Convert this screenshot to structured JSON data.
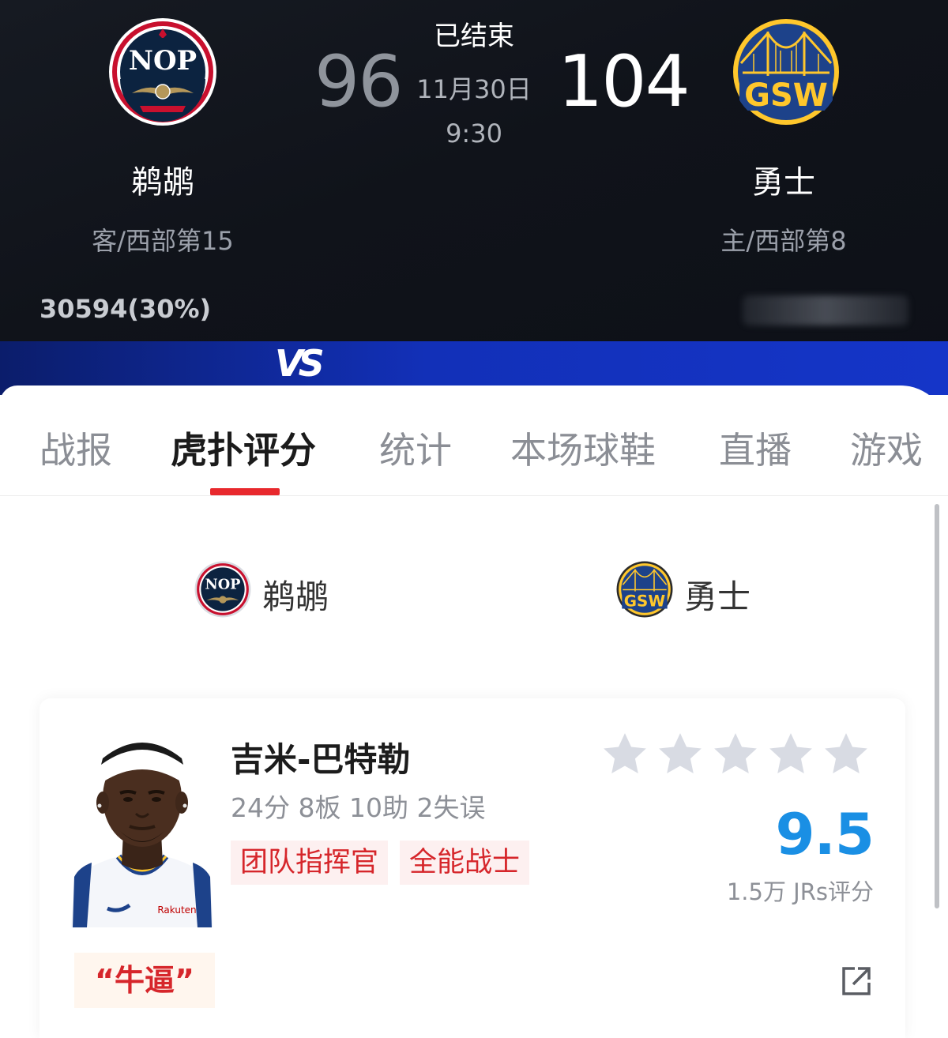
{
  "header": {
    "status": "已结束",
    "date": "11月30日",
    "time": "9:30",
    "away": {
      "name": "鹈鹕",
      "score": "96",
      "rank": "客/西部第15",
      "votes": "30594(30%)",
      "logo_text": "NOP",
      "colors": {
        "primary": "#0c2340",
        "accent": "#c8102e",
        "gold": "#b4975a"
      }
    },
    "home": {
      "name": "勇士",
      "score": "104",
      "rank": "主/西部第8",
      "logo_text": "GSW",
      "colors": {
        "primary": "#1d428a",
        "accent": "#ffc72c"
      }
    },
    "vs_label": "VS"
  },
  "tabs": [
    {
      "label": "战报"
    },
    {
      "label": "虎扑评分",
      "active": true
    },
    {
      "label": "统计"
    },
    {
      "label": "本场球鞋"
    },
    {
      "label": "直播"
    },
    {
      "label": "游戏"
    }
  ],
  "team_selector": {
    "away_label": "鹈鹕",
    "home_label": "勇士"
  },
  "player": {
    "name": "吉米-巴特勒",
    "stats": "24分 8板 10助 2失误",
    "tags": [
      "团队指挥官",
      "全能战士"
    ],
    "stars_filled": 0,
    "stars_total": 5,
    "rating": "9.5",
    "rating_count": "1.5万 JRs评分",
    "comment": "“牛逼”",
    "jersey_sponsor": "Rakuten"
  },
  "colors": {
    "accent_red": "#e8282d",
    "rating_blue": "#1a8fe4",
    "star_gray": "#d8dbe3"
  },
  "icons": {
    "share": "share-icon"
  }
}
